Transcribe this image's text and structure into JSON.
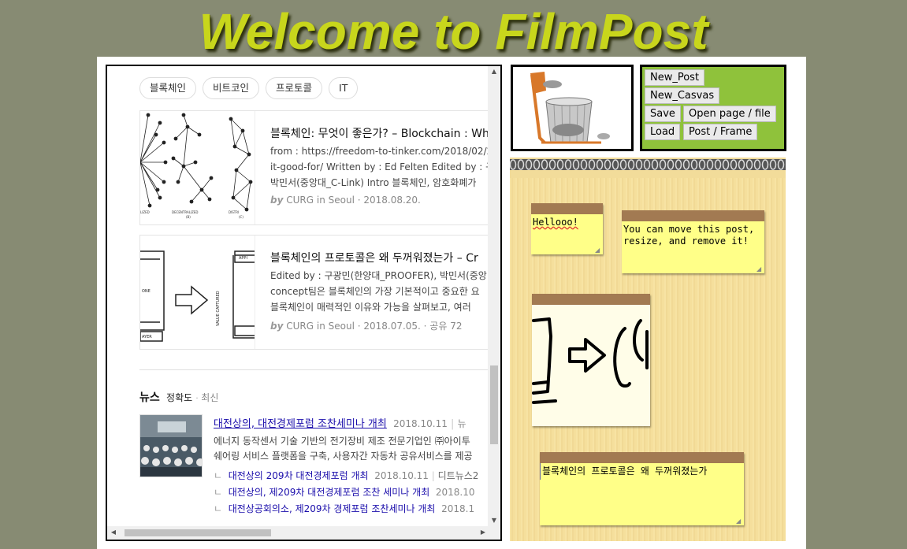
{
  "header": {
    "title": "Welcome to FilmPost"
  },
  "browser": {
    "tags": [
      "블록체인",
      "비트코인",
      "프로토콜",
      "IT"
    ],
    "cards": [
      {
        "title": "블록체인: 무엇이 좋은가? – Blockchain : Wh",
        "desc": [
          "from : https://freedom-to-tinker.com/2018/02/2",
          "it-good-for/ Written by : Ed Felten Edited by : 구",
          "박민서(중앙대_C-Link) Intro 블록체인, 암호화폐가"
        ],
        "by": "by",
        "meta": "CURG in Seoul · 2018.08.20.",
        "img_labels": [
          "LIZED",
          "DECENTRALIZED",
          "DISTRI",
          "(B)",
          "(C)"
        ]
      },
      {
        "title": "블록체인의 프로토콜은 왜 두꺼워졌는가 – Cr",
        "desc": [
          "Edited by : 구광민(한양대_PROOFER), 박민서(중앙",
          "concept팀은 블록체인의 가장 기본적이고 중요한 요",
          "블록체인이 매력적인 이유와 가능을 살펴보고, 여러"
        ],
        "by": "by",
        "meta": "CURG in Seoul · 2018.07.05. · 공유 72",
        "img_labels": [
          "APPI",
          "VALUE CAPTURED",
          "ONE",
          "AYER"
        ]
      }
    ],
    "news": {
      "heading": "뉴스",
      "sort_accuracy": "정확도",
      "sort_recent": "최신",
      "main_title": "대전상의, 대전경제포럼 조찬세미나 개최",
      "main_date": "2018.10.11",
      "main_source": "뉴",
      "desc": [
        "에너지 동작센서 기술 기반의 전기장비 제조 전문기업인 ㈜아이투",
        "쉐어링 서비스 플랫폼을 구축, 사용자간 자동차 공유서비스를 제공"
      ],
      "subs": [
        {
          "title": "대전상의 209차 대전경제포럼 개최",
          "date": "2018.10.11",
          "source": "디트뉴스2"
        },
        {
          "title": "대전상의, 제209차 대전경제포럼 조찬 세미나 개최",
          "date": "2018.10",
          "source": ""
        },
        {
          "title": "대전상공회의소, 제209차 경제포럼 조찬세미나 개최",
          "date": "2018.1",
          "source": ""
        }
      ]
    }
  },
  "buttons": {
    "new_post": "New_Post",
    "new_canvas": "New_Casvas",
    "save": "Save",
    "open": "Open page / file",
    "load": "Load",
    "post_frame": "Post / Frame"
  },
  "notes": {
    "note1": "Hellooo!",
    "note2": "You can move this post,\nresize, and remove it!",
    "note4": "블록체인의 프로토콜은 왜 두꺼워졌는가"
  },
  "colors": {
    "background": "#878b73",
    "title": "#c8d61c",
    "button_panel": "#8fc23b",
    "note": "#ffff88",
    "note_bar": "#a27a52"
  }
}
